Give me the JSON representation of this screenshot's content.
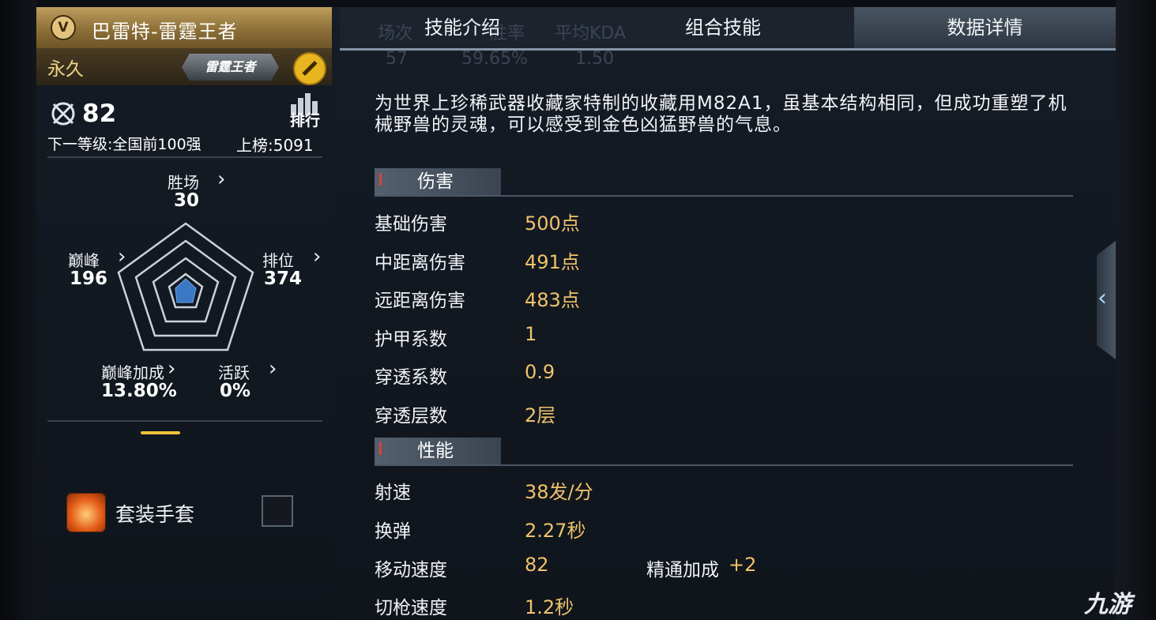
{
  "weapon": {
    "title": "巴雷特-雷霆王者",
    "badge": "V",
    "duration": "永久",
    "rank_plate": "雷霆王者"
  },
  "ranking": {
    "rank": "82",
    "leaderboard_label": "排行",
    "next_level": "下一等级:全国前100强",
    "board": "上榜:5091"
  },
  "stats": {
    "wins": {
      "label": "胜场",
      "value": "30"
    },
    "peak": {
      "label": "巅峰",
      "value": "196"
    },
    "ranked": {
      "label": "排位",
      "value": "374"
    },
    "peak_bonus": {
      "label": "巅峰加成",
      "value": "13.80%"
    },
    "activity": {
      "label": "活跃",
      "value": "0%"
    }
  },
  "glove": {
    "label": "套装手套"
  },
  "tabs": {
    "skills": "技能介绍",
    "combo": "组合技能",
    "details": "数据详情"
  },
  "ghost": {
    "col1_label": "场次",
    "col2_label": "胜率",
    "col3_label": "平均KDA",
    "col1_value": "57",
    "col2_value": "59.65%",
    "col3_value": "1.50"
  },
  "description": "为世界上珍稀武器收藏家特制的收藏用M82A1，虽基本结构相同，但成功重塑了机械野兽的灵魂，可以感受到金色凶猛野兽的气息。",
  "damage": {
    "title": "伤害",
    "rows": [
      {
        "label": "基础伤害",
        "value": "500点"
      },
      {
        "label": "中距离伤害",
        "value": "491点"
      },
      {
        "label": "远距离伤害",
        "value": "483点"
      },
      {
        "label": "护甲系数",
        "value": "1"
      },
      {
        "label": "穿透系数",
        "value": "0.9"
      },
      {
        "label": "穿透层数",
        "value": "2层"
      }
    ]
  },
  "performance": {
    "title": "性能",
    "rows": [
      {
        "label": "射速",
        "value": "38发/分"
      },
      {
        "label": "换弹",
        "value": "2.27秒"
      },
      {
        "label": "移动速度",
        "value": "82"
      },
      {
        "label": "切枪速度",
        "value": "1.2秒"
      }
    ],
    "mastery_label": "精通加成",
    "mastery_value": "+2"
  },
  "watermark": "九游",
  "colors": {
    "gold_value": "#efc26b",
    "title_gold": "#bf9e5d",
    "accent_red": "#d8433b",
    "radar_fill": "#3b78c4"
  }
}
